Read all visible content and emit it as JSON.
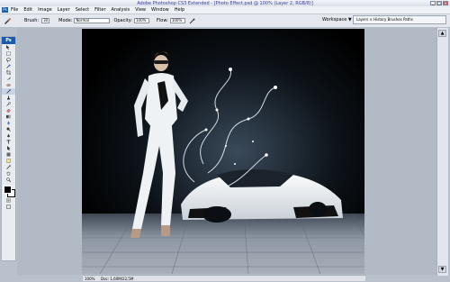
{
  "window": {
    "title": "Adobe Photoshop CS3 Extended - [Photo Effect.psd @ 100% (Layer 2, RGB/8)]",
    "buttons": [
      "_",
      "□",
      "×"
    ]
  },
  "menubar": {
    "logo": "Ps",
    "items": [
      "File",
      "Edit",
      "Image",
      "Layer",
      "Select",
      "Filter",
      "Analysis",
      "View",
      "Window",
      "Help"
    ]
  },
  "options_bar": {
    "brush_label": "Brush:",
    "brush_size": "30",
    "mode_label": "Mode:",
    "mode_value": "Normal",
    "opacity_label": "Opacity:",
    "opacity_value": "100%",
    "flow_label": "Flow:",
    "flow_value": "100%",
    "workspace_label": "Workspace ▼",
    "layers_tab": "Layers × History Brushes Paths"
  },
  "toolbox": {
    "logo": "Ps",
    "tools": [
      "move-tool-icon",
      "marquee-tool-icon",
      "lasso-tool-icon",
      "quick-select-tool-icon",
      "crop-tool-icon",
      "slice-tool-icon",
      "healing-tool-icon",
      "brush-tool-icon",
      "clone-stamp-tool-icon",
      "history-brush-tool-icon",
      "eraser-tool-icon",
      "gradient-tool-icon",
      "blur-tool-icon",
      "dodge-tool-icon",
      "pen-tool-icon",
      "type-tool-icon",
      "path-select-tool-icon",
      "shape-tool-icon",
      "notes-tool-icon",
      "eyedropper-tool-icon",
      "hand-tool-icon",
      "zoom-tool-icon"
    ]
  },
  "status": {
    "zoom": "100%",
    "doc": "Doc: 1,60M/22,5M"
  }
}
